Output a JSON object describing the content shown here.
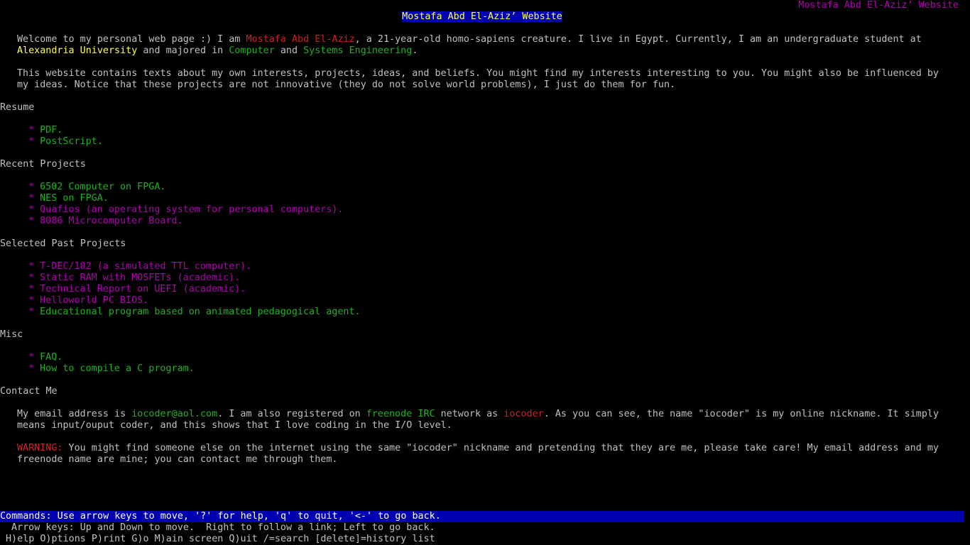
{
  "window": {
    "corner_title": "Mostafa Abd El-Aziz’ Website",
    "page_title": "Mostafa Abd El-Aziz’ Website"
  },
  "intro": {
    "line1_pre": "Welcome to my personal web page :) I am ",
    "name_link": "Mostafa Abd El-Aziz",
    "line1_post": ", a 21-year-old homo-sapiens creature. I live in Egypt. Currently, I am an undergraduate student at",
    "university": "Alexandria University",
    "line2_mid1": " and majored in ",
    "major1": "Computer",
    "line2_mid2": " and ",
    "major2": "Systems Engineering",
    "line2_end": "."
  },
  "about": {
    "line1": "This website contains texts about my own interests, projects, ideas, and beliefs. You might find my interests interesting to you. You might also be influenced by",
    "line2": "my ideas. Notice that these projects are not innovative (they do not solve world problems), I just do them for fun."
  },
  "sections": {
    "resume": "Resume",
    "recent": "Recent Projects",
    "past": "Selected Past Projects",
    "misc": "Misc",
    "contact": "Contact Me"
  },
  "bullet": "* ",
  "resume_links": [
    "PDF.",
    "PostScript."
  ],
  "recent_links": [
    "6502 Computer on FPGA.",
    "NES on FPGA.",
    "Quafios (an operating system for personal computers).",
    "8086 Microcomputer Board."
  ],
  "past_links": [
    "T-DEC/102 (a simulated TTL computer).",
    "Static RAM with MOSFETs (academic).",
    "Technical Report on UEFI (academic).",
    "Helloworld PC BIOS.",
    "Educational program based on animated pedagogical agent."
  ],
  "misc_links": [
    "FAQ.",
    "How to compile a C program."
  ],
  "contact": {
    "l1_pre": "My email address is ",
    "email": "iocoder@aol.com",
    "l1_mid": ". I am also registered on ",
    "irc": "freenode IRC",
    "l1_mid2": " network as ",
    "nick": "iocoder",
    "l1_post": ". As you can see, the name \"iocoder\" is my online nickname. It simply",
    "l2": "means input/ouput coder, and this shows that I love coding in the I/O level.",
    "warning_label": "WARNING:",
    "warn_l1": " You might find someone else on the internet using the same \"iocoder\" nickname and pretending that they are me, please take care! My email address and my",
    "warn_l2": "freenode name are mine; you can contact me through them."
  },
  "status": {
    "commands": "Commands: Use arrow keys to move, '?' for help, 'q' to quit, '<-' to go back.",
    "arrow_help": "Arrow keys: Up and Down to move.  Right to follow a link; Left to go back.",
    "key_help": "H)elp O)ptions P)rint G)o M)ain screen Q)uit /=search [delete]=history list"
  },
  "colors": {
    "background": "#000000",
    "text": "#c0c0c0",
    "link_active": "#d02020",
    "link_green": "#20b020",
    "link_magenta": "#b000b0",
    "highlight": "#ffff55",
    "status_bar": "#0000b0"
  }
}
